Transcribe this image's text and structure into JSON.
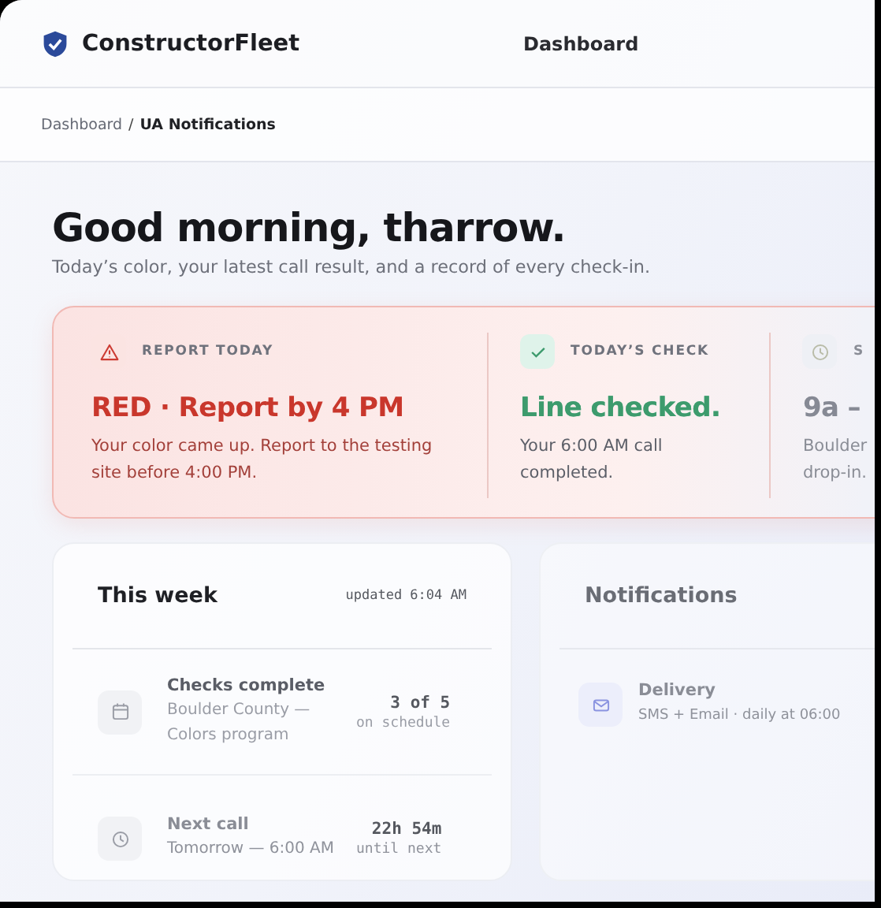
{
  "header": {
    "brand": "ConstructorFleet",
    "nav": "Dashboard"
  },
  "breadcrumb": {
    "separator": "/",
    "items": [
      {
        "label": "Dashboard",
        "current": false
      },
      {
        "label": "UA Notifications",
        "current": true
      }
    ]
  },
  "greeting": {
    "title": "Good morning, tharrow.",
    "subtitle": "Today’s color, your latest call result, and a record of every check-in."
  },
  "status": [
    {
      "kind": "alert",
      "label": "REPORT TODAY",
      "headline": "RED · Report by 4 PM",
      "detail": "Your color came up. Report to the testing site before 4:00 PM."
    },
    {
      "kind": "ok",
      "label": "TODAY’S CHECK",
      "headline": "Line checked.",
      "detail": "Your 6:00 AM call completed."
    },
    {
      "kind": "time",
      "label": "S",
      "headline": "9a –",
      "detail": "Boulder drop-in."
    }
  ],
  "week": {
    "title": "This week",
    "updated": "updated 6:04 AM",
    "rows": [
      {
        "kind": "calendar",
        "title": "Checks complete",
        "detail": "Boulder County — Colors program",
        "value": "3 of 5",
        "note": "on schedule"
      },
      {
        "kind": "clock",
        "title": "Next call",
        "detail": "Tomorrow — 6:00 AM",
        "value": "22h 54m",
        "note": "until next"
      }
    ]
  },
  "notifications": {
    "title": "Notifications",
    "rows": [
      {
        "kind": "mail",
        "title": "Delivery",
        "detail": "SMS + Email · daily at 06:00"
      }
    ]
  }
}
